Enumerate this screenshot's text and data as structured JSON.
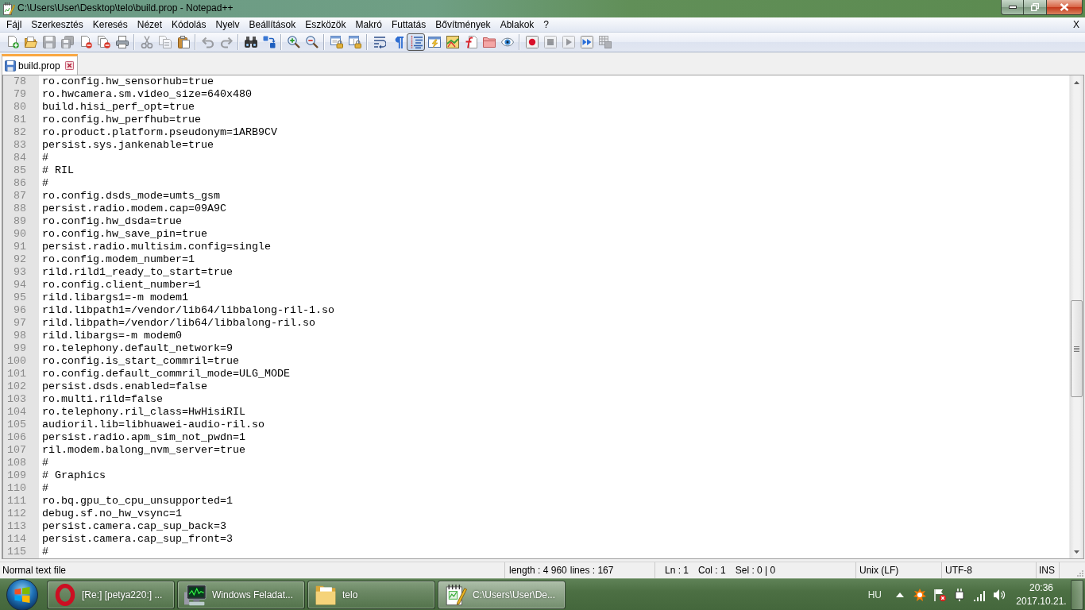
{
  "window": {
    "title": "C:\\Users\\User\\Desktop\\telo\\build.prop - Notepad++"
  },
  "menu_bar": {
    "items": [
      "Fájl",
      "Szerkesztés",
      "Keresés",
      "Nézet",
      "Kódolás",
      "Nyelv",
      "Beállítások",
      "Eszközök",
      "Makró",
      "Futtatás",
      "Bővítmények",
      "Ablakok",
      "?"
    ],
    "close_label": "X"
  },
  "toolbar": {
    "groups": [
      {
        "buttons": [
          {
            "kind": "new",
            "pressed": false,
            "disabled": false
          },
          {
            "kind": "open",
            "pressed": false,
            "disabled": false
          },
          {
            "kind": "save",
            "pressed": false,
            "disabled": true
          },
          {
            "kind": "saveall",
            "pressed": false,
            "disabled": true
          },
          {
            "kind": "close",
            "pressed": false,
            "disabled": false
          },
          {
            "kind": "closeall",
            "pressed": false,
            "disabled": false
          },
          {
            "kind": "print",
            "pressed": false,
            "disabled": false
          }
        ]
      },
      {
        "buttons": [
          {
            "kind": "cut",
            "pressed": false,
            "disabled": true
          },
          {
            "kind": "copy",
            "pressed": false,
            "disabled": true
          },
          {
            "kind": "paste",
            "pressed": false,
            "disabled": false
          }
        ]
      },
      {
        "buttons": [
          {
            "kind": "undo",
            "pressed": false,
            "disabled": true
          },
          {
            "kind": "redo",
            "pressed": false,
            "disabled": true
          }
        ]
      },
      {
        "buttons": [
          {
            "kind": "find",
            "pressed": false,
            "disabled": false
          },
          {
            "kind": "replace",
            "pressed": false,
            "disabled": false
          }
        ]
      },
      {
        "buttons": [
          {
            "kind": "zoomin",
            "pressed": false,
            "disabled": false
          },
          {
            "kind": "zoomout",
            "pressed": false,
            "disabled": false
          }
        ]
      },
      {
        "buttons": [
          {
            "kind": "syncv",
            "pressed": false,
            "disabled": false
          },
          {
            "kind": "synch",
            "pressed": false,
            "disabled": false
          }
        ]
      },
      {
        "buttons": [
          {
            "kind": "wrap",
            "pressed": false,
            "disabled": false
          },
          {
            "kind": "allchars",
            "pressed": false,
            "disabled": false
          },
          {
            "kind": "indent",
            "pressed": true,
            "disabled": false
          },
          {
            "kind": "udl",
            "pressed": false,
            "disabled": false
          },
          {
            "kind": "docmap",
            "pressed": false,
            "disabled": false
          },
          {
            "kind": "funclist",
            "pressed": false,
            "disabled": false
          },
          {
            "kind": "workspace",
            "pressed": false,
            "disabled": false
          },
          {
            "kind": "monitor",
            "pressed": false,
            "disabled": false
          }
        ]
      },
      {
        "buttons": [
          {
            "kind": "record",
            "pressed": false,
            "disabled": false
          },
          {
            "kind": "stop",
            "pressed": false,
            "disabled": true
          },
          {
            "kind": "play",
            "pressed": false,
            "disabled": true
          },
          {
            "kind": "playmulti",
            "pressed": false,
            "disabled": false
          },
          {
            "kind": "savemacro",
            "pressed": false,
            "disabled": true
          }
        ]
      }
    ]
  },
  "tabs": [
    {
      "label": "build.prop",
      "selected": true,
      "modified": false
    }
  ],
  "editor": {
    "lines": [
      {
        "number": "78",
        "text": "ro.config.hw_sensorhub=true"
      },
      {
        "number": "79",
        "text": "ro.hwcamera.sm.video_size=640x480"
      },
      {
        "number": "80",
        "text": "build.hisi_perf_opt=true"
      },
      {
        "number": "81",
        "text": "ro.config.hw_perfhub=true"
      },
      {
        "number": "82",
        "text": "ro.product.platform.pseudonym=1ARB9CV"
      },
      {
        "number": "83",
        "text": "persist.sys.jankenable=true"
      },
      {
        "number": "84",
        "text": "#"
      },
      {
        "number": "85",
        "text": "# RIL"
      },
      {
        "number": "86",
        "text": "#"
      },
      {
        "number": "87",
        "text": "ro.config.dsds_mode=umts_gsm"
      },
      {
        "number": "88",
        "text": "persist.radio.modem.cap=09A9C"
      },
      {
        "number": "89",
        "text": "ro.config.hw_dsda=true"
      },
      {
        "number": "90",
        "text": "ro.config.hw_save_pin=true"
      },
      {
        "number": "91",
        "text": "persist.radio.multisim.config=single"
      },
      {
        "number": "92",
        "text": "ro.config.modem_number=1"
      },
      {
        "number": "93",
        "text": "rild.rild1_ready_to_start=true"
      },
      {
        "number": "94",
        "text": "ro.config.client_number=1"
      },
      {
        "number": "95",
        "text": "rild.libargs1=-m modem1"
      },
      {
        "number": "96",
        "text": "rild.libpath1=/vendor/lib64/libbalong-ril-1.so"
      },
      {
        "number": "97",
        "text": "rild.libpath=/vendor/lib64/libbalong-ril.so"
      },
      {
        "number": "98",
        "text": "rild.libargs=-m modem0"
      },
      {
        "number": "99",
        "text": "ro.telephony.default_network=9"
      },
      {
        "number": "100",
        "text": "ro.config.is_start_commril=true"
      },
      {
        "number": "101",
        "text": "ro.config.default_commril_mode=ULG_MODE"
      },
      {
        "number": "102",
        "text": "persist.dsds.enabled=false"
      },
      {
        "number": "103",
        "text": "ro.multi.rild=false"
      },
      {
        "number": "104",
        "text": "ro.telephony.ril_class=HwHisiRIL"
      },
      {
        "number": "105",
        "text": "audioril.lib=libhuawei-audio-ril.so"
      },
      {
        "number": "106",
        "text": "persist.radio.apm_sim_not_pwdn=1"
      },
      {
        "number": "107",
        "text": "ril.modem.balong_nvm_server=true"
      },
      {
        "number": "108",
        "text": "#"
      },
      {
        "number": "109",
        "text": "# Graphics"
      },
      {
        "number": "110",
        "text": "#"
      },
      {
        "number": "111",
        "text": "ro.bq.gpu_to_cpu_unsupported=1"
      },
      {
        "number": "112",
        "text": "debug.sf.no_hw_vsync=1"
      },
      {
        "number": "113",
        "text": "persist.camera.cap_sup_back=3"
      },
      {
        "number": "114",
        "text": "persist.camera.cap_sup_front=3"
      },
      {
        "number": "115",
        "text": "#"
      }
    ]
  },
  "status_bar": {
    "doc_type": "Normal text file",
    "length": "length : 4 960",
    "lines": "lines : 167",
    "position": [
      "Ln : 1",
      "Col : 1",
      "Sel : 0 | 0"
    ],
    "eol": "Unix (LF)",
    "encoding": "UTF-8",
    "mode": "INS"
  },
  "taskbar": {
    "buttons": [
      {
        "kind": "browser",
        "label": "[Re:] [petya220:] ...",
        "selected": false
      },
      {
        "kind": "taskmgr",
        "label": "Windows Feladat...",
        "selected": false
      },
      {
        "kind": "folder",
        "label": "telo",
        "selected": false
      },
      {
        "kind": "editor",
        "label": "C:\\Users\\User\\De...",
        "selected": true
      }
    ],
    "language": "HU",
    "time": "20:36",
    "date": "2017.10.21."
  }
}
